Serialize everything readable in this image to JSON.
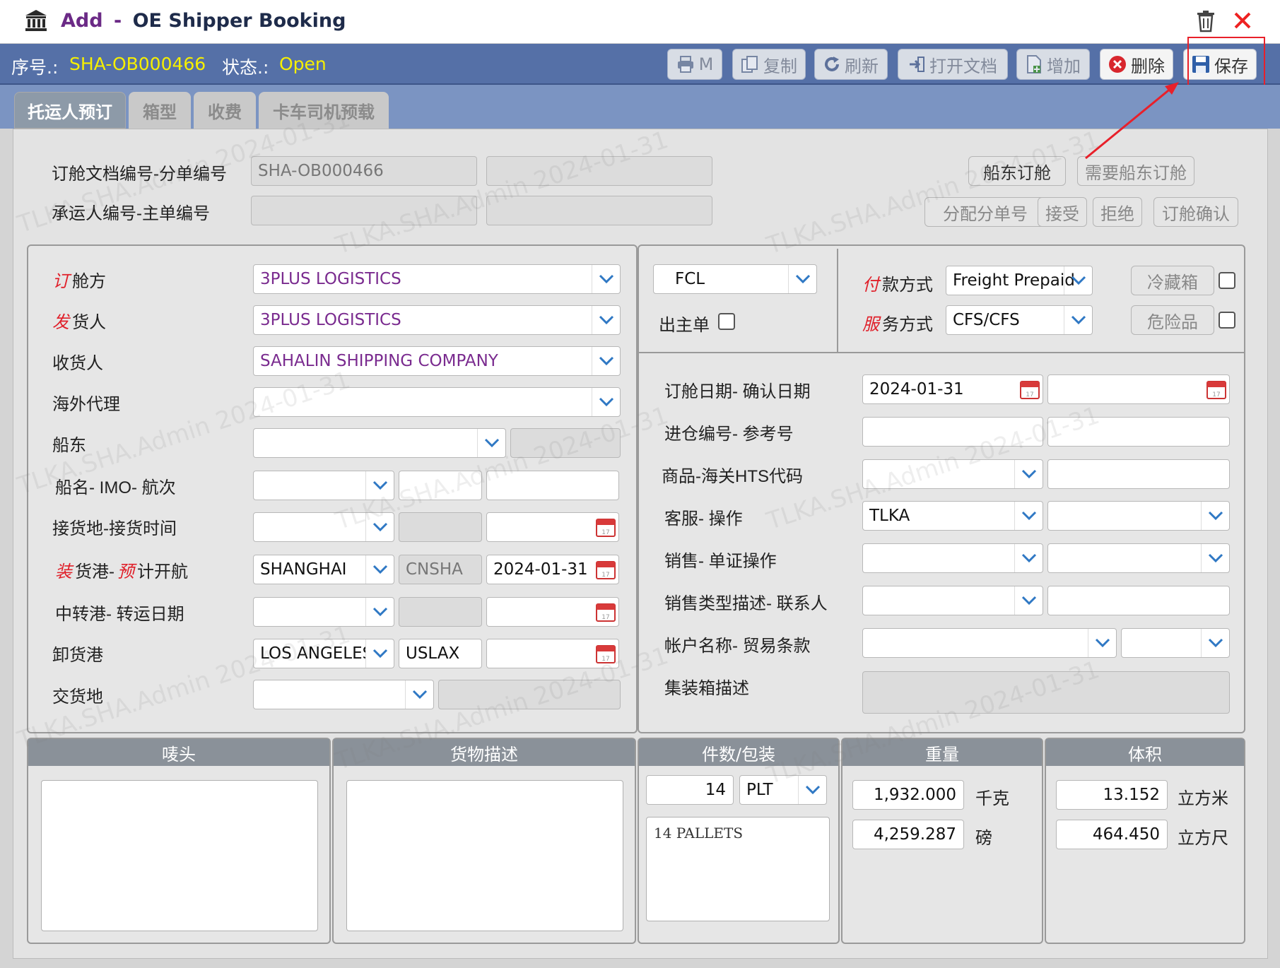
{
  "window": {
    "mode": "Add",
    "separator": "-",
    "title": "OE Shipper Booking"
  },
  "header": {
    "no_label": "序号.:",
    "no_value": "SHA-OB000466",
    "status_label": "状态.:",
    "status_value": "Open"
  },
  "toolbar": {
    "print": "M",
    "copy": "复制",
    "refresh": "刷新",
    "open_doc": "打开文档",
    "add": "增加",
    "delete": "删除",
    "save": "保存"
  },
  "tabs": [
    "托运人预订",
    "箱型",
    "收费",
    "卡车司机预载"
  ],
  "top": {
    "booking_doc_label": "订舱文档编号-分单编号",
    "booking_doc_value": "SHA-OB000466",
    "carrier_no_label": "承运人编号-主单编号",
    "btn_carrier_booking": "船东订舱",
    "btn_need_carrier_booking": "需要船东订舱",
    "btn_assign_hbl": "分配分单号",
    "btn_accept": "接受",
    "btn_reject": "拒绝",
    "btn_confirm": "订舱确认"
  },
  "left": {
    "booking_party": {
      "mark": "订",
      "rest": "舱方",
      "value": "3PLUS LOGISTICS"
    },
    "shipper": {
      "mark": "发",
      "rest": "货人",
      "value": "3PLUS LOGISTICS"
    },
    "consignee": {
      "label": "收货人",
      "value": "SAHALIN SHIPPING COMPANY"
    },
    "overseas_agent": {
      "label": "海外代理"
    },
    "carrier": {
      "label": "船东"
    },
    "vessel": {
      "label": "船名- IMO- 航次"
    },
    "receipt": {
      "label": "接货地-接货时间"
    },
    "loading": {
      "mark1": "装",
      "mid": "货港-",
      "mark2": "预",
      "rest": "计开航",
      "port": "SHANGHAI",
      "code": "CNSHA",
      "date": "2024-01-31"
    },
    "transship": {
      "label": "中转港- 转运日期"
    },
    "discharge": {
      "label": "卸货港",
      "port": "LOS ANGELES",
      "code": "USLAX"
    },
    "delivery": {
      "label": "交货地"
    }
  },
  "right": {
    "load_type": "FCL",
    "master_bill_label": "出主单",
    "payment": {
      "mark": "付",
      "rest": "款方式",
      "value": "Freight Prepaid"
    },
    "service": {
      "mark": "服",
      "rest": "务方式",
      "value": "CFS/CFS"
    },
    "reefer_btn": "冷藏箱",
    "dangerous_btn": "危险品",
    "booking_date_label": "订舱日期- 确认日期",
    "booking_date": "2024-01-31",
    "warehouse_label": "进仓编号- 参考号",
    "commodity_label": "商品-海关HTS代码",
    "cs_label": "客服- 操作",
    "cs_value": "TLKA",
    "sales_label": "销售- 单证操作",
    "sales_type_label": "销售类型描述- 联系人",
    "account_label": "帐户名称- 贸易条款",
    "container_desc_label": "集装箱描述"
  },
  "bottom": {
    "marks_header": "唛头",
    "desc_header": "货物描述",
    "pkgs_header": "件数/包装",
    "pkgs_count": "14",
    "pkgs_unit": "PLT",
    "pkgs_text": "14 PALLETS",
    "weight_header": "重量",
    "weight_kg": "1,932.000",
    "weight_kg_unit": "千克",
    "weight_lb": "4,259.287",
    "weight_lb_unit": "磅",
    "volume_header": "体积",
    "volume_cbm": "13.152",
    "volume_cbm_unit": "立方米",
    "volume_cft": "464.450",
    "volume_cft_unit": "立方尺"
  },
  "watermark": "TLKA.SHA.Admin 2024-01-31",
  "colors": {
    "header_bar": "#5570a7",
    "status_yellow": "#f6ef00",
    "tab_bar": "#7b94c2",
    "required_red": "#e0202a",
    "annotation_red": "#e8202a"
  }
}
